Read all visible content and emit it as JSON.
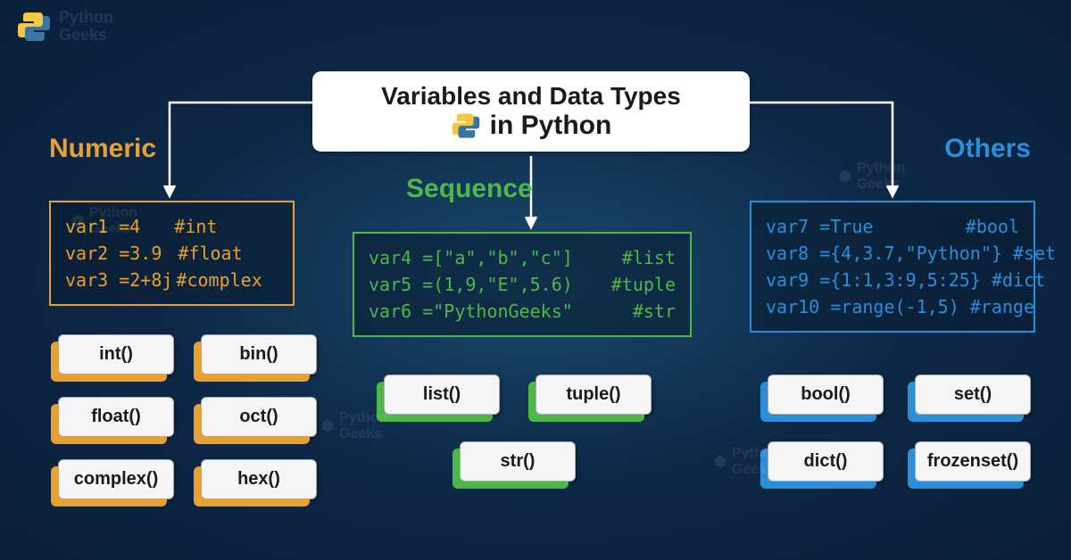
{
  "brand": {
    "line1": "Python",
    "line2": "Geeks"
  },
  "title": {
    "line1": "Variables and Data Types",
    "line2": "in Python"
  },
  "sections": {
    "numeric": {
      "label": "Numeric",
      "code": [
        {
          "var": "var1 =4",
          "comment": "#int"
        },
        {
          "var": "var2 =3.9",
          "comment": "#float"
        },
        {
          "var": "var3 =2+8j",
          "comment": "#complex"
        }
      ],
      "functions": [
        "int()",
        "bin()",
        "float()",
        "oct()",
        "complex()",
        "hex()"
      ]
    },
    "sequence": {
      "label": "Sequence",
      "code": [
        {
          "var": "var4 =[\"a\",\"b\",\"c\"]",
          "comment": "#list"
        },
        {
          "var": "var5 =(1,9,\"E\",5.6)",
          "comment": "#tuple"
        },
        {
          "var": "var6 =\"PythonGeeks\"",
          "comment": "#str"
        }
      ],
      "functions": [
        "list()",
        "tuple()",
        "str()"
      ]
    },
    "others": {
      "label": "Others",
      "code": [
        {
          "var": "var7 =True",
          "comment": "#bool"
        },
        {
          "var": "var8 ={4,3.7,\"Python\"}",
          "comment": "#set"
        },
        {
          "var": "var9 ={1:1,3:9,5:25}",
          "comment": "#dict"
        },
        {
          "var": "var10 =range(-1,5)",
          "comment": "#range"
        }
      ],
      "functions": [
        "bool()",
        "set()",
        "dict()",
        "frozenset()"
      ]
    }
  }
}
